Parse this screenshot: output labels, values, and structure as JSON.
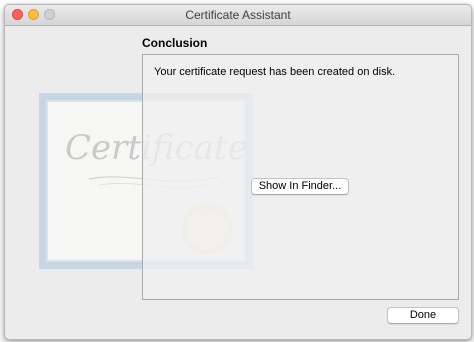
{
  "window": {
    "title": "Certificate Assistant"
  },
  "main": {
    "heading": "Conclusion",
    "message": "Your certificate request has been created on disk.",
    "show_in_finder_label": "Show In Finder...",
    "certificate_art_text": "Certificate"
  },
  "footer": {
    "done_label": "Done"
  },
  "colors": {
    "close": "#fc605c",
    "minimize": "#fdbc40",
    "zoom_disabled": "#d0d0d0",
    "window_bg": "#ececec"
  }
}
